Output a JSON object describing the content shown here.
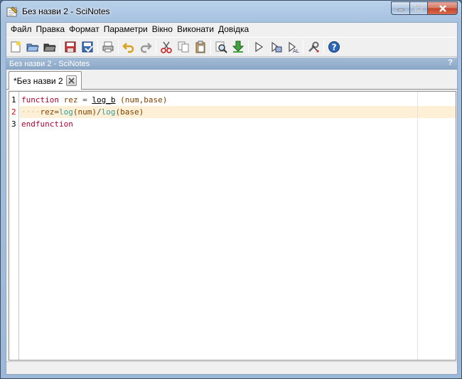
{
  "window": {
    "title": "Без назви 2 - SciNotes"
  },
  "menu": [
    "Файл",
    "Правка",
    "Формат",
    "Параметри",
    "Вікно",
    "Виконати",
    "Довідка"
  ],
  "toolbar": {
    "icons": [
      "new-file-icon",
      "open-file-icon",
      "open-recent-icon",
      "save-icon",
      "save-as-icon",
      "print-icon",
      "undo-icon",
      "redo-icon",
      "cut-icon",
      "copy-icon",
      "paste-icon",
      "find-icon",
      "load-into-scilab-icon",
      "execute-icon",
      "execute-selection-icon",
      "execute-all-icon",
      "settings-icon",
      "help-icon"
    ]
  },
  "docbar": {
    "title": "Без назви 2 - SciNotes",
    "help": "?"
  },
  "tab": {
    "label": "*Без назви 2"
  },
  "editor": {
    "line_numbers": [
      "1",
      "2",
      "3"
    ],
    "lines": [
      {
        "kw": "function",
        "s1": " ",
        "var": "rez",
        "s2": " = ",
        "fn": "log_b",
        "s3": " ",
        "args": "(num,base)"
      },
      {
        "indent": "····",
        "assign": "rez=",
        "f1": "log",
        "a1": "(num)",
        "div": "/",
        "f2": "log",
        "a2": "(base)"
      },
      {
        "kw": "endfunction"
      }
    ]
  },
  "colors": {
    "keyword": "#ae0035",
    "variable": "#804000",
    "builtin": "#32a09d",
    "current_line": "#fdf0d6"
  }
}
